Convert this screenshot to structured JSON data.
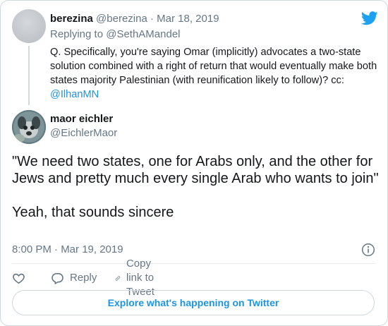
{
  "parent_tweet": {
    "name": "berezina",
    "handle": "@berezina",
    "date_sep": " · ",
    "date": "Mar 18, 2019",
    "replying_prefix": "Replying to ",
    "replying_to": "@SethAMandel",
    "text": "Q. Specifically, you're saying Omar (implicitly) advocates a two-state solution combined with a right of return that would eventually make both states majority Palestinian (with reunification likely to follow)? cc: ",
    "mention": "@IlhanMN"
  },
  "main_tweet": {
    "name": "maor eichler",
    "handle": "@EichlerMaor",
    "text_para1": "\"We need two states, one for Arabs only, and the other for Jews and pretty much every single Arab who wants to join\"",
    "text_para2": "Yeah, that sounds sincere",
    "timestamp": "8:00 PM · Mar 19, 2019"
  },
  "actions": {
    "reply_label": "Reply",
    "copy_link_label": "Copy link to Tweet"
  },
  "explore_label": "Explore what's happening on Twitter",
  "icons": {
    "brand": "twitter-bird-icon",
    "like": "heart-icon",
    "reply": "speech-bubble-icon",
    "copy_link": "link-icon",
    "info": "info-icon"
  },
  "colors": {
    "brand_blue": "#1da1f2",
    "link_blue": "#1b95e0",
    "muted_text": "#657786",
    "border": "#cfd9de"
  }
}
